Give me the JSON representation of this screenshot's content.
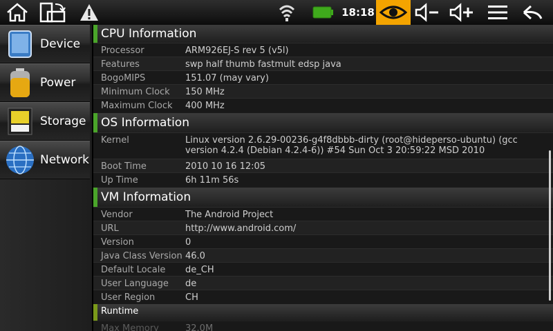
{
  "status_bar": {
    "time": "18:18",
    "icons": [
      "home-icon",
      "rotate-screen-icon",
      "warning-icon",
      "wifi-icon",
      "battery-icon",
      "eye-icon",
      "volume-down-icon",
      "volume-up-icon",
      "menu-icon",
      "back-icon"
    ],
    "accent_color": "#f4a400"
  },
  "sidebar": {
    "items": [
      {
        "label": "Device",
        "icon": "device-icon"
      },
      {
        "label": "Power",
        "icon": "battery-icon"
      },
      {
        "label": "Storage",
        "icon": "sd-card-icon"
      },
      {
        "label": "Network",
        "icon": "globe-icon"
      }
    ]
  },
  "sections": {
    "cpu": {
      "title": "CPU Information",
      "rows": [
        {
          "key": "Processor",
          "value": "ARM926EJ-S rev 5 (v5l)"
        },
        {
          "key": "Features",
          "value": "swp half thumb fastmult edsp java"
        },
        {
          "key": "BogoMIPS",
          "value": "151.07 (may vary)"
        },
        {
          "key": "Minimum Clock",
          "value": "150 MHz"
        },
        {
          "key": "Maximum Clock",
          "value": "400 MHz"
        }
      ]
    },
    "os": {
      "title": "OS Information",
      "rows": [
        {
          "key": "Kernel",
          "value": "Linux version 2.6.29-00236-g4f8dbbb-dirty (root@hideperso-ubuntu) (gcc version 4.2.4 (Debian 4.2.4-6)) #54 Sun Oct 3 20:59:22 MSD 2010"
        },
        {
          "key": "Boot Time",
          "value": "2010 10 16 12:05"
        },
        {
          "key": "Up Time",
          "value": "6h 11m 56s"
        }
      ]
    },
    "vm": {
      "title": "VM Information",
      "rows": [
        {
          "key": "Vendor",
          "value": "The Android Project"
        },
        {
          "key": "URL",
          "value": "http://www.android.com/"
        },
        {
          "key": "Version",
          "value": "0"
        },
        {
          "key": "Java Class Version",
          "value": "46.0"
        },
        {
          "key": "Default Locale",
          "value": "de_CH"
        },
        {
          "key": "User Language",
          "value": "de"
        },
        {
          "key": "User Region",
          "value": "CH"
        }
      ]
    },
    "runtime": {
      "title": "Runtime",
      "rows": [
        {
          "key": "Max Memory",
          "value": "32.0M"
        }
      ]
    }
  },
  "colors": {
    "section_marker": "#4aa52a",
    "runtime_marker": "#7a9a1a"
  }
}
